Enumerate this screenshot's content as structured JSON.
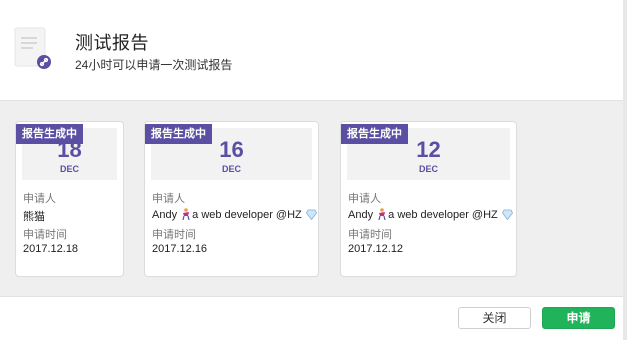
{
  "header": {
    "title": "测试报告",
    "subtitle": "24小时可以申请一次测试报告"
  },
  "cards": [
    {
      "badge": "报告生成中",
      "day": "18",
      "month": "DEC",
      "applicant_label": "申请人",
      "applicant": "熊猫",
      "time_label": "申请时间",
      "time": "2017.12.18"
    },
    {
      "badge": "报告生成中",
      "day": "16",
      "month": "DEC",
      "applicant_label": "申请人",
      "applicant_name": "Andy",
      "applicant_desc": "a web developer @HZ",
      "time_label": "申请时间",
      "time": "2017.12.16"
    },
    {
      "badge": "报告生成中",
      "day": "12",
      "month": "DEC",
      "applicant_label": "申请人",
      "applicant_name": "Andy",
      "applicant_desc": "a web developer @HZ",
      "time_label": "申请时间",
      "time": "2017.12.12"
    }
  ],
  "footer": {
    "close_label": "关闭",
    "apply_label": "申请"
  },
  "colors": {
    "accent": "#5b4fa3",
    "primary_button": "#21b35a"
  },
  "icons": [
    "document-icon",
    "link-badge-icon",
    "person-emoji-icon",
    "diamond-emoji-icon"
  ]
}
